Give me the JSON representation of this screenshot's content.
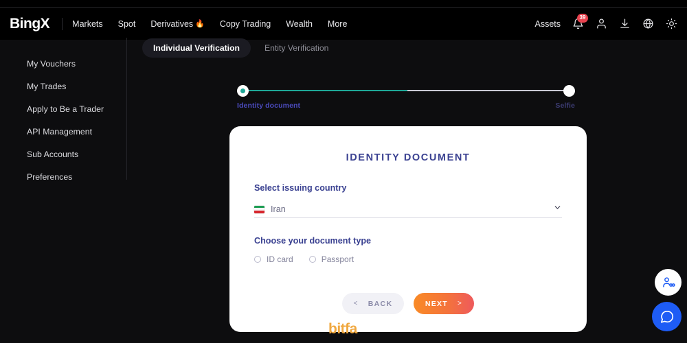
{
  "brand": {
    "logo_text": "BingX",
    "watermark": "bitfa"
  },
  "header": {
    "nav": [
      {
        "label": "Markets",
        "icon": ""
      },
      {
        "label": "Spot",
        "icon": ""
      },
      {
        "label": "Derivatives",
        "icon": "fire-emoji"
      },
      {
        "label": "Copy Trading",
        "icon": ""
      },
      {
        "label": "Wealth",
        "icon": ""
      },
      {
        "label": "More",
        "icon": ""
      }
    ],
    "assets_label": "Assets",
    "notification_badge": "39",
    "icons": [
      "bell-icon",
      "user-icon",
      "download-icon",
      "globe-icon",
      "brightness-icon"
    ]
  },
  "sidebar": {
    "items": [
      {
        "label": "My Vouchers"
      },
      {
        "label": "My Trades"
      },
      {
        "label": "Apply to Be a Trader"
      },
      {
        "label": "API Management"
      },
      {
        "label": "Sub Accounts"
      },
      {
        "label": "Preferences"
      }
    ]
  },
  "tabs": [
    {
      "label": "Individual Verification",
      "active": true
    },
    {
      "label": "Entity Verification",
      "active": false
    }
  ],
  "stepper": {
    "steps": [
      {
        "label": "Identity document",
        "state": "active"
      },
      {
        "label": "Selfie",
        "state": "pending"
      }
    ],
    "progress_percent": "50",
    "active_color": "#1ea897",
    "track_color": "#c9c9d4"
  },
  "card": {
    "title": "IDENTITY DOCUMENT",
    "country_field": {
      "label": "Select issuing country",
      "value": "Iran",
      "flag": "iran-flag",
      "chevron": "chevron-down-icon"
    },
    "document_type": {
      "label": "Choose your document type",
      "options": [
        {
          "label": "ID card",
          "selected": false
        },
        {
          "label": "Passport",
          "selected": false
        }
      ]
    },
    "buttons": {
      "back_arrow": "<",
      "back_label": "BACK",
      "next_label": "NEXT",
      "next_arrow": ">",
      "next_color": "#f4743b"
    }
  },
  "fabs": [
    {
      "name": "invite-friends-icon"
    },
    {
      "name": "chat-support-icon"
    }
  ]
}
